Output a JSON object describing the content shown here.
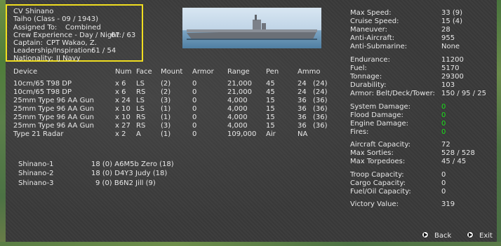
{
  "ship": {
    "name": "CV Shinano",
    "class_line": "Taiho (Class - 09 / 1943)",
    "assigned_label": "Assigned To:",
    "assigned_value": "Combined",
    "crew_label": "Crew Experience - Day / Night:",
    "crew_value": "67  /  63",
    "captain_label": "Captain:",
    "captain_value": "CPT Wakao, Z.",
    "leadership_label": "Leadership/Inspiration:",
    "leadership_value": "61  /  54",
    "nationality_label": "Nationality:",
    "nationality_value": "IJ Navy"
  },
  "devices": {
    "headers": [
      "Device",
      "Num",
      "Face",
      "Mount",
      "Armor",
      "Range",
      "Pen",
      "Ammo"
    ],
    "rows": [
      {
        "device": "10cm/65 T98 DP",
        "num": "x 6",
        "face": "LS",
        "mount": "(2)",
        "armor": "0",
        "range": "21,000",
        "pen": "45",
        "ammo": "24",
        "ammo_max": "(24)"
      },
      {
        "device": "10cm/65 T98 DP",
        "num": "x 6",
        "face": "RS",
        "mount": "(2)",
        "armor": "0",
        "range": "21,000",
        "pen": "45",
        "ammo": "24",
        "ammo_max": "(24)"
      },
      {
        "device": "25mm Type 96 AA Gun",
        "num": "x 24",
        "face": "LS",
        "mount": "(3)",
        "armor": "0",
        "range": "4,000",
        "pen": "15",
        "ammo": "36",
        "ammo_max": "(36)"
      },
      {
        "device": "25mm Type 96 AA Gun",
        "num": "x 10",
        "face": "LS",
        "mount": "(1)",
        "armor": "0",
        "range": "4,000",
        "pen": "15",
        "ammo": "36",
        "ammo_max": "(36)"
      },
      {
        "device": "25mm Type 96 AA Gun",
        "num": "x 10",
        "face": "RS",
        "mount": "(1)",
        "armor": "0",
        "range": "4,000",
        "pen": "15",
        "ammo": "36",
        "ammo_max": "(36)"
      },
      {
        "device": "25mm Type 96 AA Gun",
        "num": "x 27",
        "face": "RS",
        "mount": "(3)",
        "armor": "0",
        "range": "4,000",
        "pen": "15",
        "ammo": "36",
        "ammo_max": "(36)"
      },
      {
        "device": "Type 21 Radar",
        "num": "x 2",
        "face": "A",
        "mount": "(1)",
        "armor": "0",
        "range": "109,000",
        "pen": "Air",
        "ammo": "NA",
        "ammo_max": ""
      }
    ]
  },
  "air_groups": [
    {
      "name": "Shinano-1",
      "info": "18 (0) A6M5b Zero (18)"
    },
    {
      "name": "Shinano-2",
      "info": "18 (0) D4Y3 Judy (18)"
    },
    {
      "name": "Shinano-3",
      "info": "9 (0) B6N2 Jill (9)"
    }
  ],
  "stats": {
    "max_speed_label": "Max Speed:",
    "max_speed": "33 (9)",
    "cruise_speed_label": "Cruise Speed:",
    "cruise_speed": "15 (4)",
    "maneuver_label": "Maneuver:",
    "maneuver": "28",
    "anti_aircraft_label": "Anti-Aircraft:",
    "anti_aircraft": "955",
    "anti_sub_label": "Anti-Submarine:",
    "anti_sub": "None",
    "endurance_label": "Endurance:",
    "endurance": "11200",
    "fuel_label": "Fuel:",
    "fuel": "5170",
    "tonnage_label": "Tonnage:",
    "tonnage": "29300",
    "durability_label": "Durability:",
    "durability": "103",
    "armor_label": "Armor: Belt/Deck/Tower:",
    "armor": "150 / 95 / 25",
    "sys_dmg_label": "System Damage:",
    "sys_dmg": "0",
    "flood_dmg_label": "Flood Damage:",
    "flood_dmg": "0",
    "engine_dmg_label": "Engine Damage:",
    "engine_dmg": "0",
    "fires_label": "Fires:",
    "fires": "0",
    "aircraft_cap_label": "Aircraft Capacity:",
    "aircraft_cap": "72",
    "max_sorties_label": "Max Sorties:",
    "max_sorties": "528 / 528",
    "max_torp_label": "Max Torpedoes:",
    "max_torp": "45 / 45",
    "troop_cap_label": "Troop Capacity:",
    "troop_cap": "0",
    "cargo_cap_label": "Cargo Capacity:",
    "cargo_cap": "0",
    "fuel_oil_cap_label": "Fuel/Oil Capacity:",
    "fuel_oil_cap": "0",
    "victory_label": "Victory Value:",
    "victory": "319"
  },
  "nav": {
    "back_label": "Back",
    "exit_label": "Exit"
  },
  "colors": {
    "highlight_box": "#f0dd20",
    "ok_green": "#19e019"
  }
}
